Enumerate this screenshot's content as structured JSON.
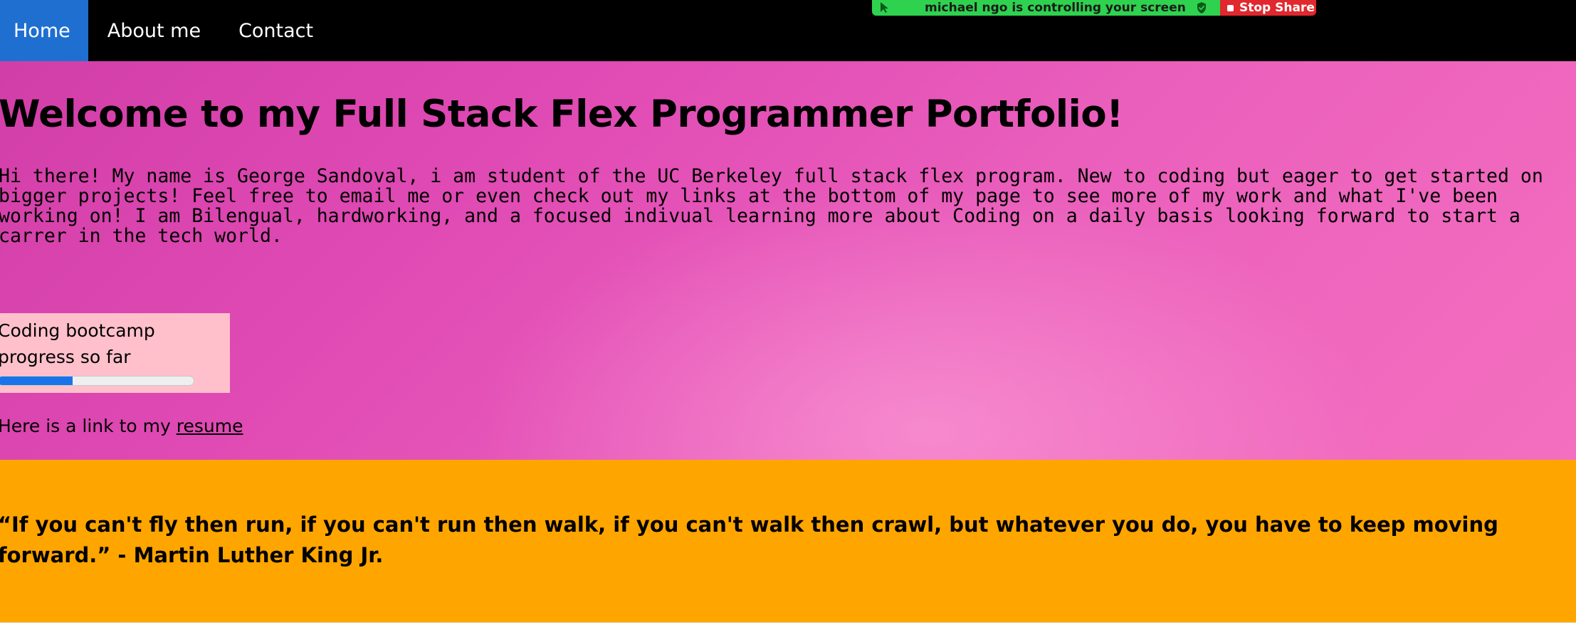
{
  "nav": {
    "items": [
      {
        "label": "Home",
        "active": true
      },
      {
        "label": "About me",
        "active": false
      },
      {
        "label": "Contact",
        "active": false
      }
    ],
    "active_color": "#1f6fd0"
  },
  "share_banner": {
    "status_text": "michael ngo is controlling your screen",
    "stop_label": "Stop Share",
    "green_color": "#2fd24e",
    "red_color": "#e0282e"
  },
  "hero": {
    "title": "Welcome to my Full Stack Flex Programmer Portfolio!",
    "intro": "Hi there! My name is George Sandoval, i am student of the UC Berkeley full stack flex program. New to coding but eager to get started on bigger projects! Feel free to email me or even check out my links at the bottom of my page to see more of my work and what I've been working on! I am Bilengual, hardworking, and a focused indivual learning more about Coding on a daily basis looking forward to start a carrer in the tech world.",
    "progress": {
      "label": "Coding bootcamp progress so far",
      "value": 0.38,
      "fill_color": "#1a73e8",
      "box_color": "#ffc0cb"
    },
    "resume": {
      "prefix": "Here is a link to my ",
      "link_text": "resume"
    }
  },
  "quote": {
    "text": "“If you can't fly then run, if you can't run then walk, if you can't walk then crawl, but whatever you do, you have to keep moving forward.” - Martin Luther King Jr.",
    "background": "#ffa500"
  }
}
